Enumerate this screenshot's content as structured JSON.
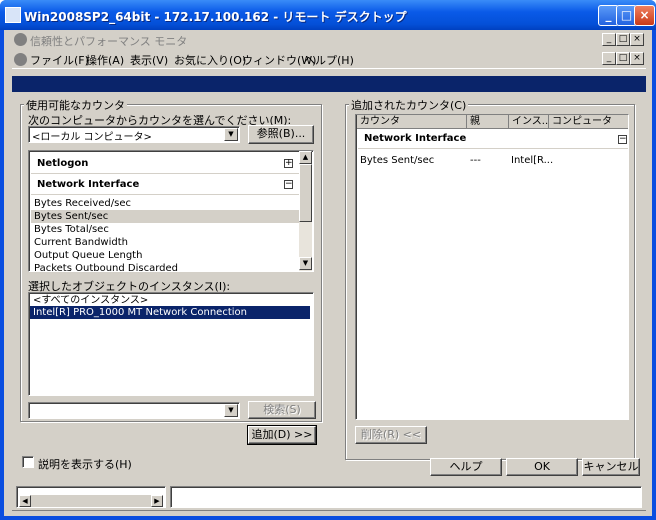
{
  "window": {
    "title": "Win2008SP2_64bit - 172.17.100.162 - リモート デスクトップ"
  },
  "mmc": {
    "title": "信頼性とパフォーマンス モニタ",
    "menu": [
      "ファイル(F)",
      "操作(A)",
      "表示(V)",
      "お気に入り(O)",
      "ウィンドウ(W)",
      "ヘルプ(H)"
    ]
  },
  "available": {
    "group_label": "使用可能なカウンタ",
    "computer_label": "次のコンピュータからカウンタを選んでください(M):",
    "computer_value": "<ローカル コンピュータ>",
    "browse_button": "参照(B)...",
    "categories": [
      {
        "name": "Netlogon",
        "expander": "+"
      },
      {
        "name": "Network Interface",
        "expander": "−"
      }
    ],
    "counters": [
      "Bytes Received/sec",
      "Bytes Sent/sec",
      "Bytes Total/sec",
      "Current Bandwidth",
      "Output Queue Length",
      "Packets Outbound Discarded"
    ],
    "selected_counter": 1,
    "instances_label": "選択したオブジェクトのインスタンス(I):",
    "instances": [
      "<すべてのインスタンス>",
      "Intel[R] PRO_1000 MT Network Connection"
    ],
    "selected_instance": 1,
    "search_button": "検索(S)",
    "add_button": "追加(D) >>"
  },
  "added": {
    "group_label": "追加されたカウンタ(C)",
    "columns": [
      "カウンタ",
      "親",
      "インス...",
      "コンピュータ"
    ],
    "category": "Network Interface",
    "category_expander": "−",
    "row": {
      "counter": "Bytes Sent/sec",
      "parent": "---",
      "instance": "Intel[R..."
    },
    "remove_button": "削除(R) <<"
  },
  "footer": {
    "show_description": "説明を表示する(H)",
    "help_button": "ヘルプ",
    "ok_button": "OK",
    "cancel_button": "キャンセル"
  }
}
